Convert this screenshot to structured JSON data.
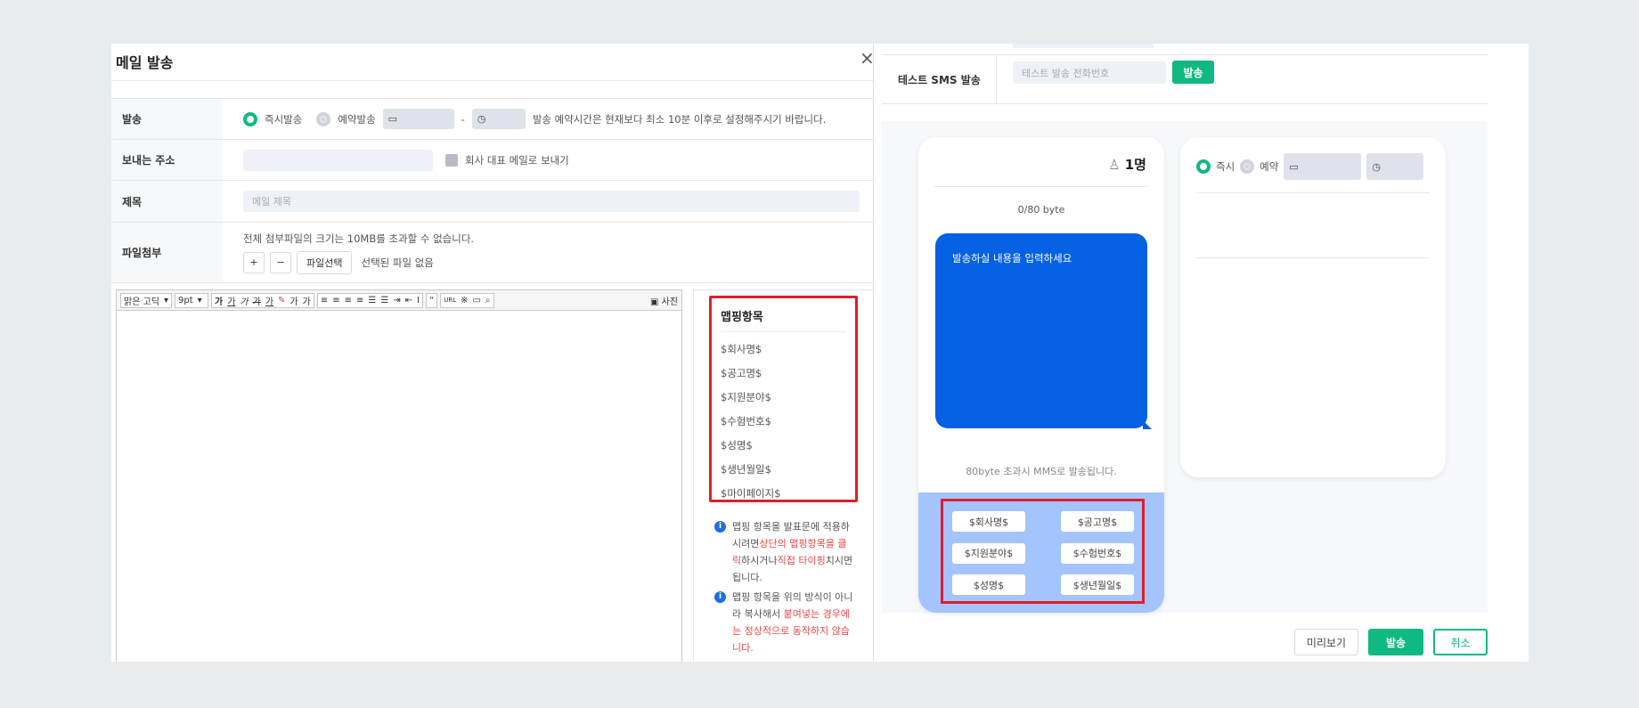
{
  "dialog": {
    "title": "메일 발송",
    "close": "×"
  },
  "form": {
    "send": {
      "label": "발송",
      "immediate": "즉시발송",
      "scheduled": "예약발송",
      "dash": "-",
      "hint": "발송 예약시간은 현재보다 최소 10분 이후로 설정해주시기 바랍니다."
    },
    "from": {
      "label": "보내는 주소",
      "checkbox_label": "회사 대표 메일로 보내기"
    },
    "subject": {
      "label": "제목",
      "placeholder": "메일 제목"
    },
    "attach": {
      "label": "파일첨부",
      "hint": "전체 첨부파일의 크기는 10MB를 초과할 수 없습니다.",
      "add": "+",
      "remove": "−",
      "choose": "파일선택",
      "status": "선택된 파일 없음"
    }
  },
  "editor": {
    "font": "맑은 고딕",
    "size": "9pt",
    "bold": "가",
    "underline": "가",
    "italic": "가",
    "strike": "가",
    "color": "가",
    "sup": "가",
    "sub": "가",
    "quote": "“",
    "url": "URL",
    "photo": "사진"
  },
  "mapping": {
    "title": "맵핑항목",
    "items": [
      "$회사명$",
      "$공고명$",
      "$지원분야$",
      "$수험번호$",
      "$성명$",
      "$생년월일$",
      "$마이페이지$"
    ],
    "note1": {
      "a": "맵핑 항목을 발표문에 적용하시려면",
      "b": "상단의 맵핑항목을 클릭",
      "c": "하시거나",
      "d": "직접 타이핑",
      "e": "치시면 됩니다."
    },
    "note2": {
      "a": "맵핑 항목을 위의 방식이 아니라 복사해서 ",
      "b": "붙여넣는 경우에는 정상적으로 동작하지 않습니다."
    }
  },
  "sms": {
    "test_label": "테스트 SMS 발송",
    "test_placeholder": "테스트 발송 전화번호",
    "test_send": "발송",
    "recipients": "1명",
    "bytes": "0/80 byte",
    "placeholder": "발송하실 내용을 입력하세요",
    "mms_notice": "80byte 초과시 MMS로 발송됩니다.",
    "chips": [
      "$회사명$",
      "$공고명$",
      "$지원분야$",
      "$수험번호$",
      "$성명$",
      "$생년월일$"
    ],
    "immediate": "즉시",
    "scheduled": "예약"
  },
  "footer": {
    "preview": "미리보기",
    "send": "발송",
    "cancel": "취소"
  },
  "colors": {
    "green": "#10b981",
    "blue": "#0561e3",
    "light_blue": "#a4c4ff",
    "red": "#e11d2a"
  }
}
